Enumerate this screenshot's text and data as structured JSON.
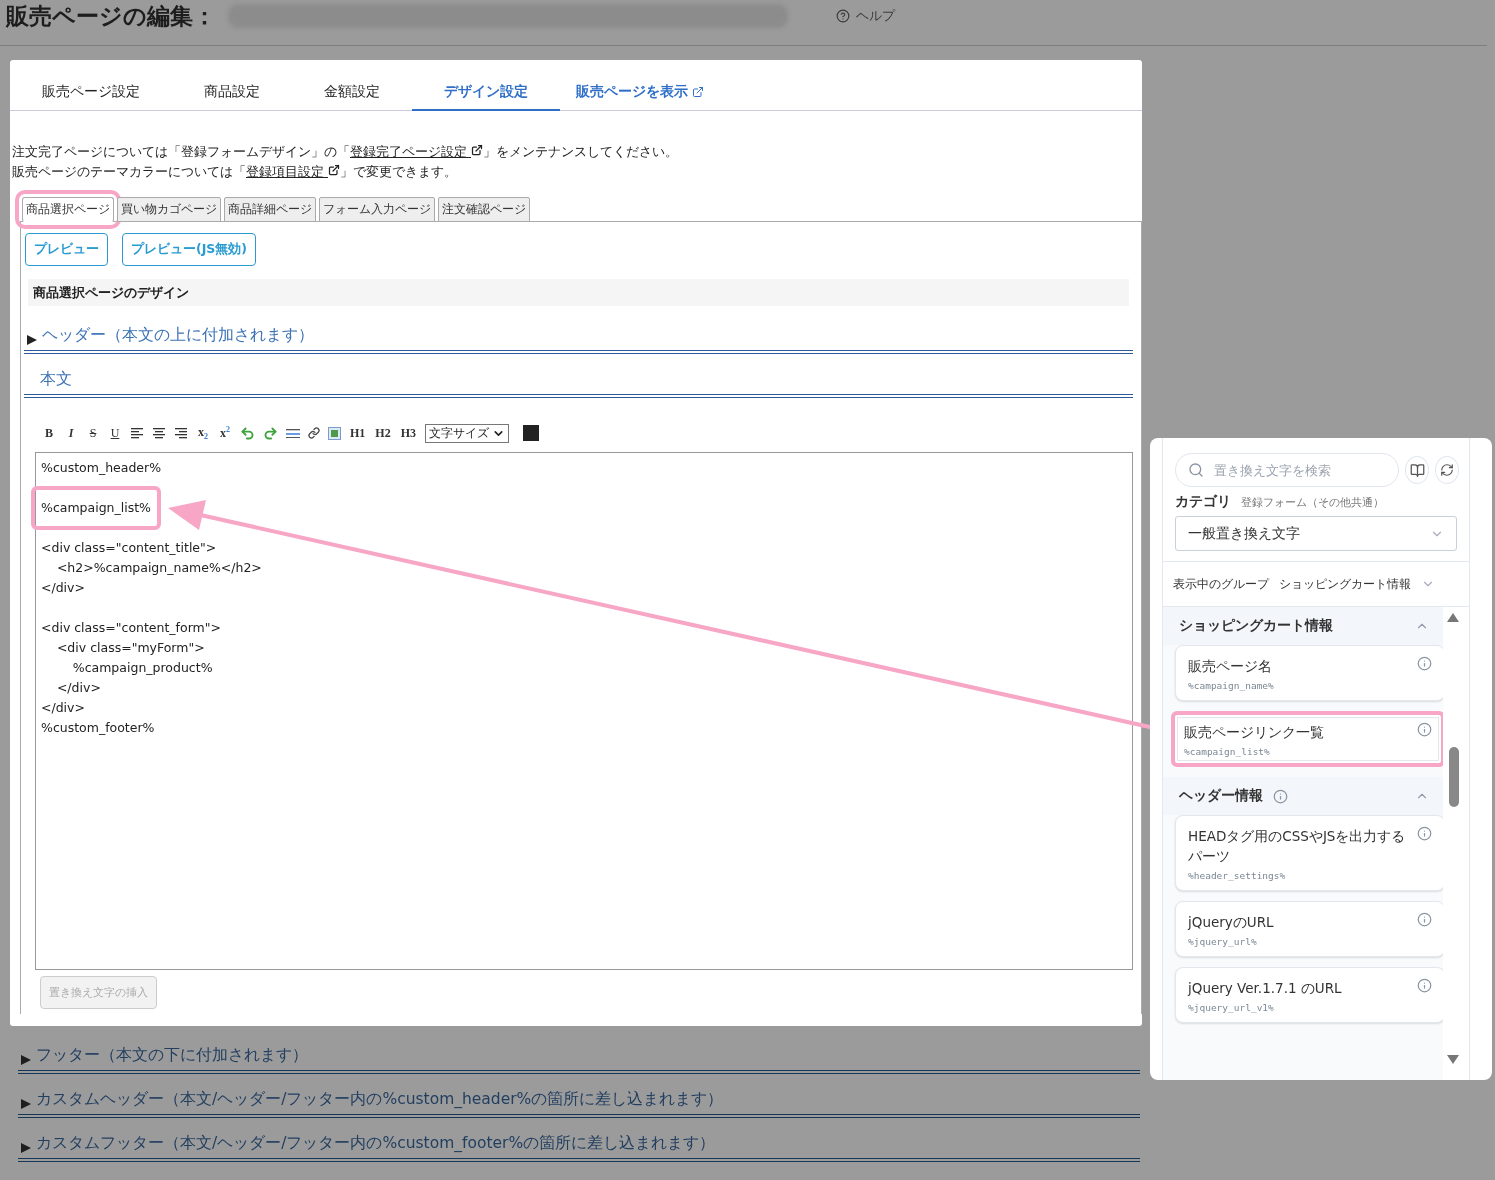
{
  "header": {
    "title": "販売ページの編集：",
    "help": "ヘルプ"
  },
  "tabs": [
    {
      "label": "販売ページ設定",
      "selected": false
    },
    {
      "label": "商品設定",
      "selected": false
    },
    {
      "label": "金額設定",
      "selected": false
    },
    {
      "label": "デザイン設定",
      "selected": true
    }
  ],
  "view_link": "販売ページを表示",
  "notes": [
    {
      "before": "注文完了ページについては「登録フォームデザイン」の「",
      "link": "登録完了ページ設定",
      "after": "」をメンテナンスしてください。"
    },
    {
      "before": "販売ページのテーマカラーについては「",
      "link": "登録項目設定",
      "after": "」で変更できます。"
    }
  ],
  "page_tabs": [
    {
      "label": "商品選択ページ",
      "selected": true,
      "highlighted": true
    },
    {
      "label": "買い物カゴページ",
      "selected": false,
      "highlighted": false
    },
    {
      "label": "商品詳細ページ",
      "selected": false,
      "highlighted": false
    },
    {
      "label": "フォーム入力ページ",
      "selected": false,
      "highlighted": false
    },
    {
      "label": "注文確認ページ",
      "selected": false,
      "highlighted": false
    }
  ],
  "preview_buttons": [
    "プレビュー",
    "プレビュー(JS無効)"
  ],
  "design_heading": "商品選択ページのデザイン",
  "sections_top": [
    {
      "title": "ヘッダー（本文の上に付加されます）",
      "expanded": false
    },
    {
      "title": "本文",
      "expanded": true
    }
  ],
  "toolbar": {
    "bold": "B",
    "italic": "I",
    "strike": "S",
    "underline": "U",
    "subscript": "x$_{2}$",
    "superscript": "x$^{2}$",
    "h1": "H1",
    "h2": "H2",
    "h3": "H3",
    "font_size": "文字サイズ"
  },
  "editor_lines": [
    {
      "kind": "code",
      "text": "%custom_header%",
      "highlighted": false
    },
    {
      "kind": "blank"
    },
    {
      "kind": "code",
      "text": "%campaign_list%",
      "highlighted": true
    },
    {
      "kind": "blank"
    },
    {
      "kind": "code",
      "text": "<div class=\"content_title\">",
      "highlighted": false
    },
    {
      "kind": "code",
      "text": "    <h2>%campaign_name%</h2>",
      "highlighted": false
    },
    {
      "kind": "code",
      "text": "</div>",
      "highlighted": false
    },
    {
      "kind": "blank"
    },
    {
      "kind": "code",
      "text": "<div class=\"content_form\">",
      "highlighted": false
    },
    {
      "kind": "code",
      "text": "    <div class=\"myForm\">",
      "highlighted": false
    },
    {
      "kind": "code",
      "text": "        %campaign_product%",
      "highlighted": false
    },
    {
      "kind": "code",
      "text": "    </div>",
      "highlighted": false
    },
    {
      "kind": "code",
      "text": "</div>",
      "highlighted": false
    },
    {
      "kind": "code",
      "text": "%custom_footer%",
      "highlighted": false
    }
  ],
  "insert_button": {
    "label": "置き換え文字の挿入",
    "disabled": true
  },
  "sections_bottom": [
    {
      "title": "フッター（本文の下に付加されます）",
      "expanded": false
    },
    {
      "title": "カスタムヘッダー（本文/ヘッダー/フッター内の%custom_header%の箇所に差し込まれます）",
      "expanded": false
    },
    {
      "title": "カスタムフッター（本文/ヘッダー/フッター内の%custom_footer%の箇所に差し込まれます）",
      "expanded": false
    }
  ],
  "placeholder_panel": {
    "search_placeholder": "置き換え文字を検索",
    "category_label": "カテゴリ",
    "category_note": "登録フォーム（その他共通）",
    "category_value": "一般置き換え文字",
    "group_label": "表示中のグループ",
    "group_value": "ショッピングカート情報",
    "groups": [
      {
        "title": "ショッピングカート情報",
        "expanded": true,
        "info": false,
        "items": [
          {
            "name": "販売ページ名",
            "code": "%campaign_name%",
            "highlighted": false
          },
          {
            "name": "販売ページリンク一覧",
            "code": "%campaign_list%",
            "highlighted": true
          }
        ]
      },
      {
        "title": "ヘッダー情報",
        "expanded": true,
        "info": true,
        "items": [
          {
            "name": "HEADタグ用のCSSやJSを出力するパーツ",
            "code": "%header_settings%",
            "highlighted": false
          },
          {
            "name": "jQueryのURL",
            "code": "%jquery_url%",
            "highlighted": false
          },
          {
            "name": "jQuery Ver.1.7.1 のURL",
            "code": "%jquery_url_v1%",
            "highlighted": false
          }
        ]
      }
    ]
  }
}
